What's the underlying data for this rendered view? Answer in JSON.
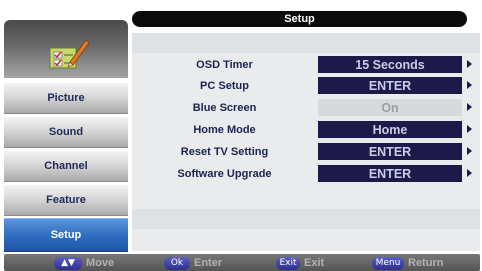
{
  "title": "Setup",
  "sidebar": {
    "logo_icon": "edit-checklist-icon",
    "items": [
      {
        "label": "Picture"
      },
      {
        "label": "Sound"
      },
      {
        "label": "Channel"
      },
      {
        "label": "Feature"
      },
      {
        "label": "Setup",
        "active": true
      }
    ]
  },
  "rows": [
    {
      "label": "OSD Timer",
      "value": "15 Seconds",
      "enabled": true
    },
    {
      "label": "PC Setup",
      "value": "ENTER",
      "enabled": true
    },
    {
      "label": "Blue Screen",
      "value": "On",
      "enabled": false
    },
    {
      "label": "Home Mode",
      "value": "Home",
      "enabled": true
    },
    {
      "label": "Reset TV Setting",
      "value": "ENTER",
      "enabled": true
    },
    {
      "label": "Software Upgrade",
      "value": "ENTER",
      "enabled": true
    }
  ],
  "hints": [
    {
      "key": "▲▼",
      "label": "Move"
    },
    {
      "key": "Ok",
      "label": "Enter"
    },
    {
      "key": "Exit",
      "label": "Exit"
    },
    {
      "key": "Menu",
      "label": "Return"
    }
  ],
  "colors": {
    "value_bg": "#1d1a4a",
    "active_tab": "#2f6bbf",
    "label_text": "#1c2352"
  }
}
